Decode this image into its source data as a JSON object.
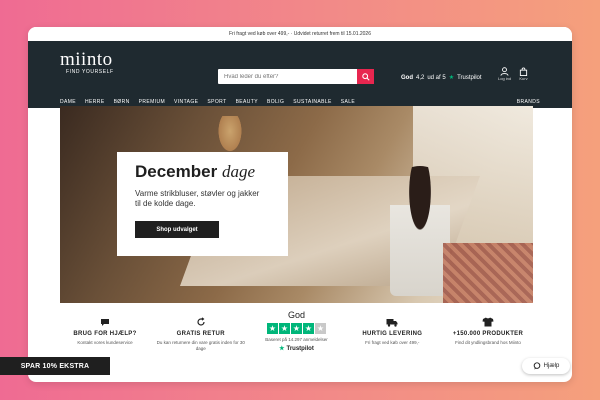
{
  "topbar": {
    "text": "Fri fragt ved køb over 499,- · Udvidet returret frem til 15.01.2026"
  },
  "header": {
    "logo": "miinto",
    "tagline": "FIND YOURSELF",
    "search_placeholder": "Hvad leder du efter?",
    "rating_label": "God",
    "rating_score": "4,2",
    "rating_out_of": "ud af 5",
    "trustpilot_label": "Trustpilot",
    "user_label": "Log ind",
    "bag_label": "Kurv"
  },
  "nav": {
    "items": [
      "DAME",
      "HERRE",
      "BØRN",
      "PREMIUM",
      "VINTAGE",
      "SPORT",
      "BEAUTY",
      "BOLIG",
      "SUSTAINABLE",
      "SALE"
    ],
    "brands": "BRANDS"
  },
  "hero": {
    "title_strong": "December",
    "title_italic": "dage",
    "subtitle": "Varme strikbluser, støvler og jakker til de kolde dage.",
    "button": "Shop udvalget"
  },
  "usps": {
    "help_title": "BRUG FOR HJÆLP?",
    "help_desc": "Kontakt vores kundeservice",
    "returns_title": "GRATIS RETUR",
    "returns_desc": "Du kan returnere din vare gratis inden for 30 dage",
    "trustpilot_god": "God",
    "trustpilot_text": "Baseret på 14.297 anmeldelser",
    "trustpilot_brand": "Trustpilot",
    "shipping_title": "HURTIG LEVERING",
    "shipping_desc": "Fri fragt ved køb over 499,-",
    "products_title": "+150.000 PRODUKTER",
    "products_desc": "Find dit yndlingsbrand hos Miinto"
  },
  "spar": "SPAR 10% EKSTRA",
  "help_button": "Hjælp",
  "colors": {
    "header_bg": "#1f2a30",
    "accent": "#e8264f",
    "trustpilot_green": "#00b67a"
  }
}
